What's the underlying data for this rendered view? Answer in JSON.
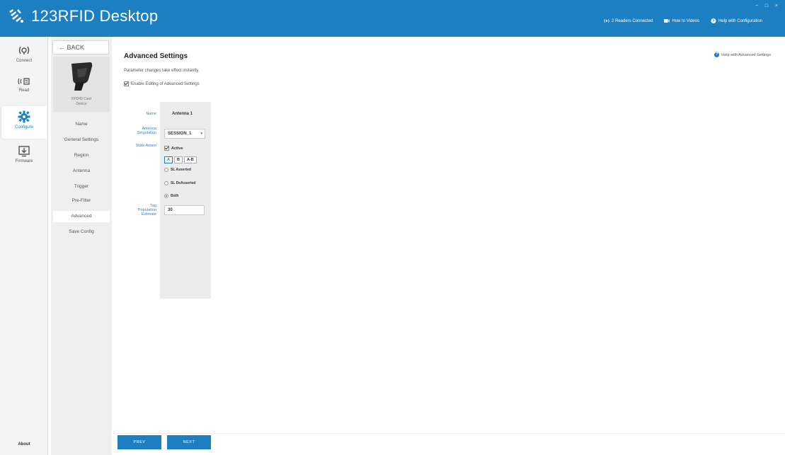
{
  "header": {
    "app_title": "123RFID Desktop",
    "readers_connected": "2 Readers Connected",
    "how_to_videos": "How to Videos",
    "help_configuration": "Help with Configuration",
    "window_controls": [
      "−",
      "□",
      "×"
    ]
  },
  "leftnav": {
    "items": [
      {
        "label": "Connect",
        "icon": "connect-icon"
      },
      {
        "label": "Read",
        "icon": "read-icon"
      },
      {
        "label": "Configure",
        "icon": "gear-icon"
      },
      {
        "label": "Firmware",
        "icon": "firmware-download-icon"
      }
    ],
    "active": "Configure",
    "about": "About"
  },
  "subnav": {
    "back_label": "← BACK",
    "device_name_line1": "RFD40 Card",
    "device_name_line2": "Device",
    "items": [
      "Name",
      "General Settings",
      "Region",
      "Antenna",
      "Trigger",
      "Pre-Filter",
      "Advanced",
      "Save Config"
    ],
    "active": "Advanced"
  },
  "main": {
    "title": "Advanced Settings",
    "description": "Parameter changes take effect instantly.",
    "enable_editing_label": "Enable Editing of Advanced Settings",
    "enable_editing_checked": true,
    "help_advanced": "Help with Advanced Settings",
    "labels": {
      "name": "Name",
      "singulation_line1": "Antenna",
      "singulation_line2": "Singulation",
      "state_aware": "State Aware",
      "tag_pop_line1": "Tag",
      "tag_pop_line2": "Population",
      "tag_pop_line3": "Estimate"
    },
    "antenna": {
      "name": "Antenna 1",
      "singulation_value": "SESSION_1",
      "active_label": "Active",
      "active_checked": true,
      "segments": [
        "A",
        "B",
        "A-B"
      ],
      "segment_selected": "A",
      "radios": [
        "SL Asserted",
        "SL DeAsserted",
        "Both"
      ],
      "radio_selected": "Both",
      "tag_population": "30"
    }
  },
  "footer": {
    "prev_label": "PREV",
    "next_label": "NEXT"
  },
  "colors": {
    "brand": "#1b7fc1",
    "label_blue": "#3b82c4"
  }
}
